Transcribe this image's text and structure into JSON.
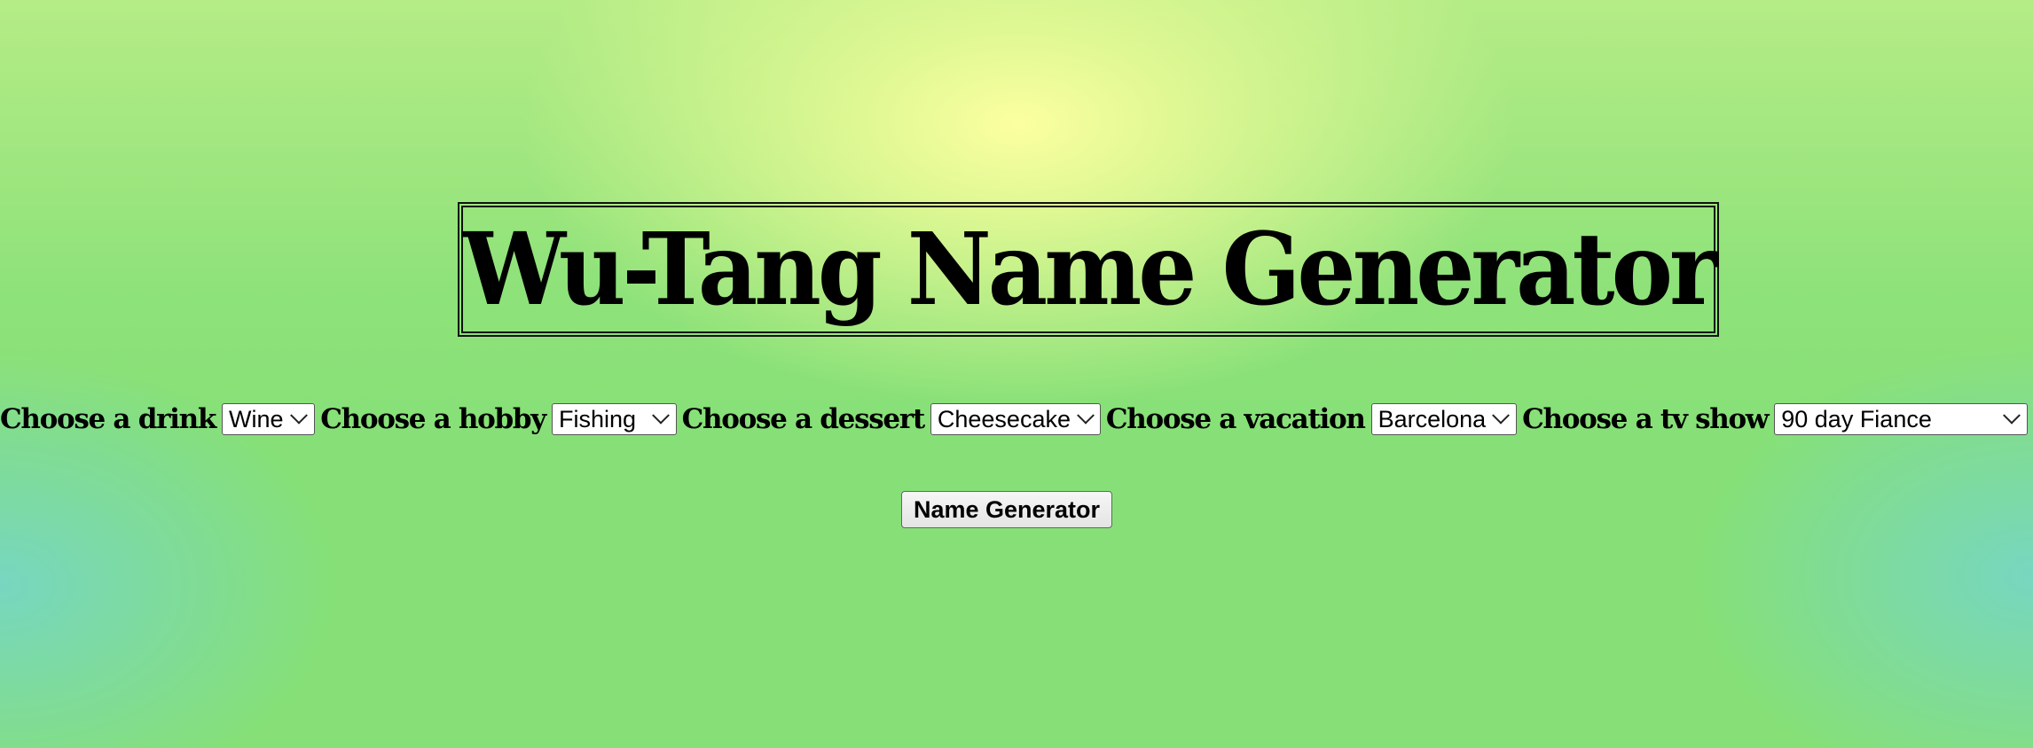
{
  "header": {
    "title": "Wu-Tang Name Generator"
  },
  "form": {
    "fields": [
      {
        "label": "Choose a drink",
        "selected": "Wine"
      },
      {
        "label": "Choose a hobby",
        "selected": "Fishing"
      },
      {
        "label": "Choose a dessert",
        "selected": "Cheesecake"
      },
      {
        "label": "Choose a vacation",
        "selected": "Barcelona"
      },
      {
        "label": "Choose a tv show",
        "selected": "90 day Fiance"
      }
    ],
    "submit_label": "Name Generator"
  },
  "icons": {
    "dropdown": "chevron-down-icon"
  },
  "colors": {
    "background_green": "#86e077",
    "background_yellow_glow": "#fcffa0",
    "background_teal_corners": "#76d6c4",
    "text": "#000000"
  }
}
